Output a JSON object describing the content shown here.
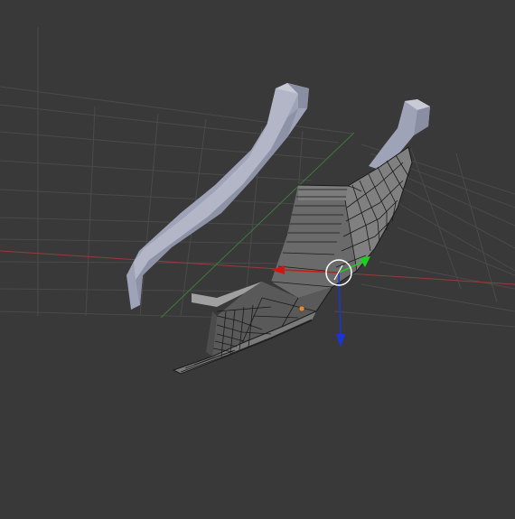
{
  "viewport": {
    "background_color": "#393939",
    "grid_color": "#4a4a4a",
    "x_axis_color": "#9a3a3a",
    "y_axis_color": "#3d7a3d"
  },
  "scene": {
    "objects": [
      {
        "name": "left-arm-curved-bar",
        "color": "#9fa3b8",
        "state": "unselected"
      },
      {
        "name": "right-arm-curved-bar",
        "color": "#9fa3b8",
        "state": "unselected"
      },
      {
        "name": "seat-mesh",
        "color": "#6a6a6a",
        "state": "edit-mode",
        "wire_color": "#1a1a1a"
      }
    ]
  },
  "gizmo": {
    "x_arrow_color": "#d01515",
    "y_arrow_color": "#1fcf1f",
    "z_arrow_color": "#1a35d6",
    "pivot_color": "#e08a3c",
    "center_ring_color": "#ffffff"
  }
}
